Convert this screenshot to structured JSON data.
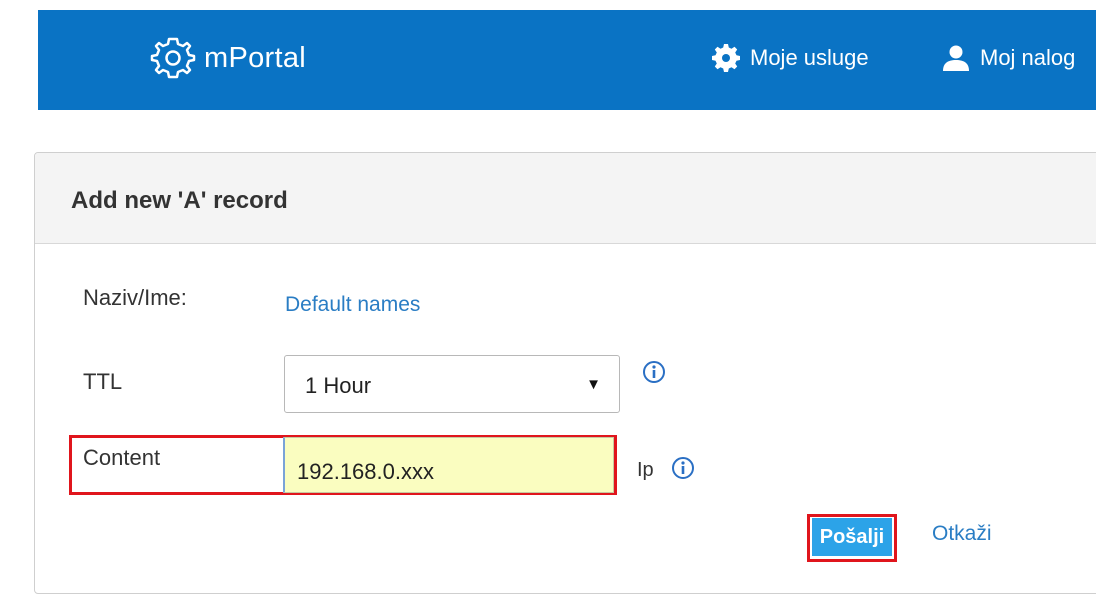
{
  "header": {
    "brand": "mPortal",
    "nav": [
      {
        "label": "Moje usluge",
        "icon": "gear-icon"
      },
      {
        "label": "Moj nalog",
        "icon": "user-icon"
      }
    ]
  },
  "form": {
    "title": "Add new 'A' record",
    "name_label": "Naziv/Ime:",
    "name_link": "Default names",
    "ttl_label": "TTL",
    "ttl_value": "1 Hour",
    "content_label": "Content",
    "content_value": "192.168.0.xxx",
    "content_hint": "Ip",
    "submit_label": "Pošalji",
    "cancel_label": "Otkaži"
  },
  "colors": {
    "header_bg": "#0a73c4",
    "link": "#2a7dc4",
    "highlight_box": "#e0151c",
    "input_bg": "#fafdc0",
    "button_bg": "#2ca3e8"
  }
}
